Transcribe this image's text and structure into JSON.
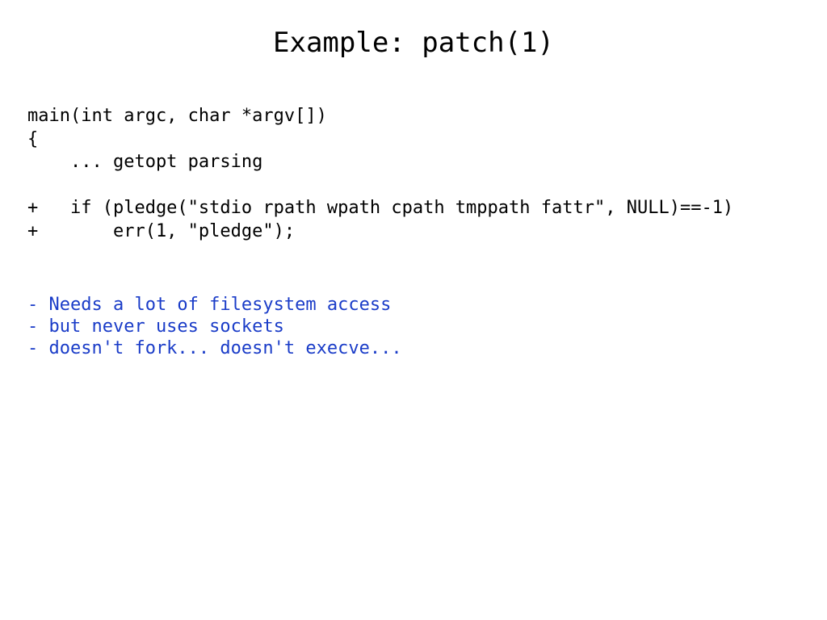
{
  "slide": {
    "title": "Example: patch(1)",
    "code_lines": [
      "main(int argc, char *argv[])",
      "{",
      "    ... getopt parsing",
      "",
      "+   if (pledge(\"stdio rpath wpath cpath tmppath fattr\", NULL)==-1)",
      "+       err(1, \"pledge\");"
    ],
    "notes": [
      "- Needs a lot of filesystem access",
      "- but never uses sockets",
      "- doesn't fork... doesn't execve..."
    ],
    "colors": {
      "background": "#ffffff",
      "code_text": "#000000",
      "notes_text": "#1a3cc8"
    }
  }
}
